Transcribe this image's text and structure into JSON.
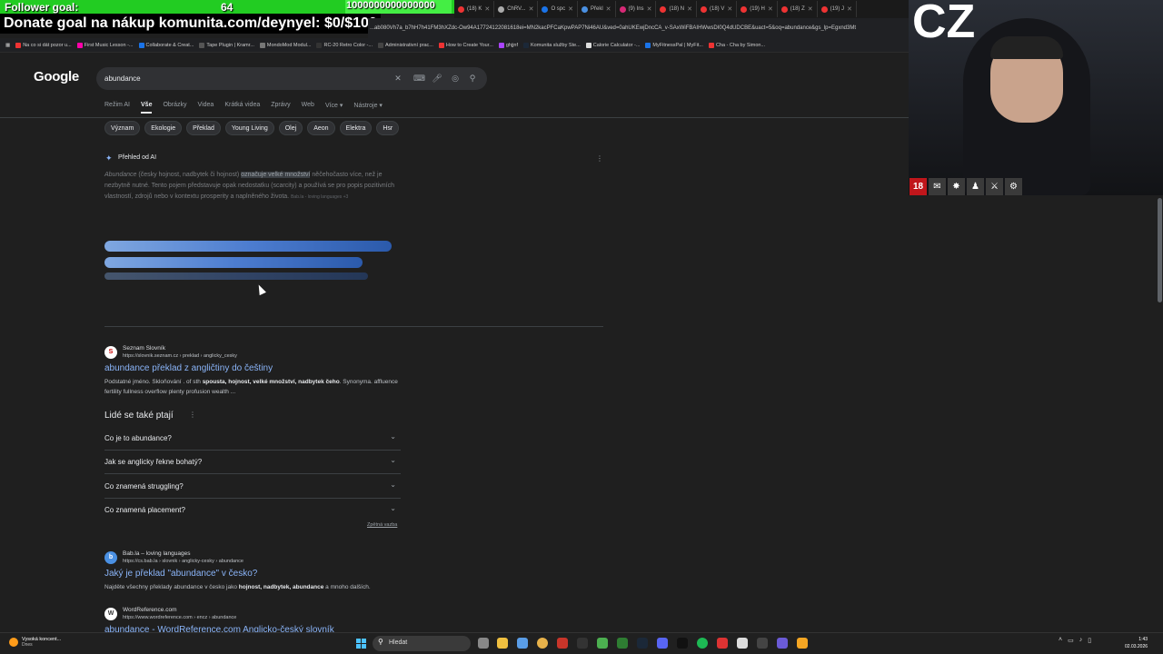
{
  "overlay": {
    "follower_label": "Follower goal:",
    "follower_count": "64",
    "follower_target": "1000000000000000",
    "donate_text": "Donate goal na nákup komunita.com/deynyel: $0/$100"
  },
  "browser": {
    "tabs": [
      {
        "label": "(18) K",
        "color": "#e33"
      },
      {
        "label": "ChRV...",
        "color": "#aaa"
      },
      {
        "label": "O spc",
        "color": "#1a73e8"
      },
      {
        "label": "Překl",
        "color": "#4a90e2"
      },
      {
        "label": "(9) Ins",
        "color": "#d62976"
      },
      {
        "label": "(18) N",
        "color": "#e33"
      },
      {
        "label": "(18) V",
        "color": "#e33"
      },
      {
        "label": "(19) H",
        "color": "#e33"
      },
      {
        "label": "(18) Z",
        "color": "#e33"
      },
      {
        "label": "(19) J",
        "color": "#e33"
      }
    ],
    "url": "...ab080Vh7a_b7hH7h41FM3hXZdc-Ow94A17724122081618ei=MN2kacPFCaKpwPAP7Ni46AU&ved=0ahUKEwjDncCA_v-SAxWiFBAIHWwsDI0Q4dUDCBE&uact=5&oq=abundance&gs_lp=Egxnd3Mt",
    "bookmarks": [
      {
        "label": "Na co si dát pozor u...",
        "color": "#e33"
      },
      {
        "label": "First Music Lesson -...",
        "color": "#f0a"
      },
      {
        "label": "Collaborate & Creat...",
        "color": "#1a73e8"
      },
      {
        "label": "Tape Plugin | Kramr...",
        "color": "#555"
      },
      {
        "label": "MondoMod Modul...",
        "color": "#777"
      },
      {
        "label": "RC-20 Retro Color -...",
        "color": "#333"
      },
      {
        "label": "Administrativní prac...",
        "color": "#444"
      },
      {
        "label": "How to Create Your...",
        "color": "#e33"
      },
      {
        "label": "ghjjnf",
        "color": "#a4f"
      },
      {
        "label": "Komunita služby Ste...",
        "color": "#1b2838"
      },
      {
        "label": "Calorie Calculator -...",
        "color": "#ddd"
      },
      {
        "label": "MyFitnessPal | MyFit...",
        "color": "#1a73e8"
      },
      {
        "label": "Cha - Cha by Simon...",
        "color": "#e33"
      }
    ]
  },
  "google": {
    "logo": "Google",
    "query": "abundance",
    "nav": [
      "Režim AI",
      "Vše",
      "Obrázky",
      "Videa",
      "Krátká videa",
      "Zprávy",
      "Web",
      "Více ▾",
      "Nástroje ▾"
    ],
    "chips": [
      "Význam",
      "Ekologie",
      "Překlad",
      "Young Living",
      "Olej",
      "Aeon",
      "Elektra",
      "Hsr"
    ]
  },
  "ai_overview": {
    "title": "Přehled od AI",
    "italic_term": "Abundance",
    "text_a": " (česky hojnost, nadbytek či hojnost) ",
    "highlight": "označuje velké množství",
    "text_b": " něčehočasto více, než je nezbytně nutné.",
    "text_c": " Tento pojem představuje opak nedostatku (scarcity) a používá se pro popis pozitivních vlastností, zdrojů nebo v kontextu prosperity a naplněného života.",
    "source": "Bab.la - loving languages +3"
  },
  "results": [
    {
      "site": "Seznam Slovník",
      "url": "https://slovnik.seznam.cz › preklad › anglicky_cesky",
      "title": "abundance překlad z angličtiny do češtiny",
      "snippet_a": "Podstatné jméno. Skloňování . of sth ",
      "snippet_b": "spousta, hojnost, velké množství, nadbytek čeho",
      "snippet_c": ". Synonyma. affluence fertility fullness overflow plenty profusion wealth ..."
    },
    {
      "site": "Bab.la – loving languages",
      "url": "https://cs.bab.la › slovnik › anglicky-cesky › abundance",
      "title": "Jaký je překlad \"abundance\" v česko?",
      "snippet_a": "Najděte všechny překlady abundance v česko jako ",
      "snippet_b": "hojnost, nadbytek, abundance",
      "snippet_c": " a mnoho dalších."
    },
    {
      "site": "WordReference.com",
      "url": "https://www.wordreference.com › encz › abundance",
      "title": "abundance - WordReference.com Anglicko-český slovník"
    }
  ],
  "paa": {
    "title": "Lidé se také ptají",
    "questions": [
      "Co je to abundance?",
      "Jak se anglicky řekne bohatý?",
      "Co znamená struggling?",
      "Co znamená placement?"
    ],
    "feedback": "Zpětná vazba"
  },
  "webcam": {
    "label": "CZ"
  },
  "taskbar": {
    "weather_title": "Vysoká koncent...",
    "weather_sub": "Dnes",
    "search_label": "Hledat",
    "time": "1:43",
    "date": "02.03.2026"
  }
}
